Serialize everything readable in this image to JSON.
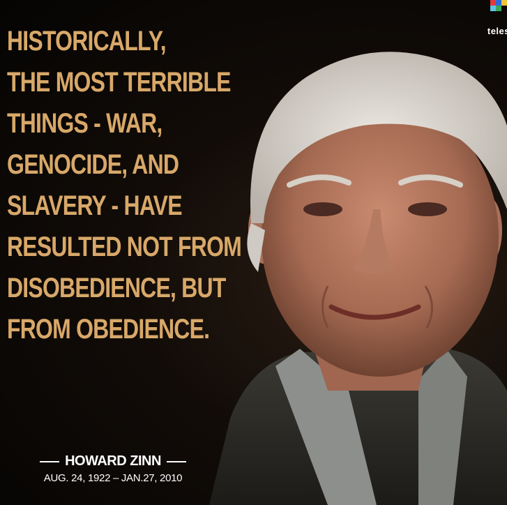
{
  "quote": {
    "lines": [
      "HISTORICALLY,",
      "THE MOST TERRIBLE",
      "THINGS - WAR,",
      "GENOCIDE, AND",
      "SLAVERY - HAVE",
      "RESULTED NOT FROM",
      "DISOBEDIENCE, BUT",
      "FROM OBEDIENCE."
    ]
  },
  "attribution": {
    "author": "HOWARD ZINN",
    "dates": "AUG. 24, 1922 – JAN.27, 2010"
  },
  "logo": {
    "text": "teles"
  },
  "colors": {
    "quote_text": "#d8a869",
    "background": "#0b0806",
    "attribution_text": "#ffffff"
  }
}
